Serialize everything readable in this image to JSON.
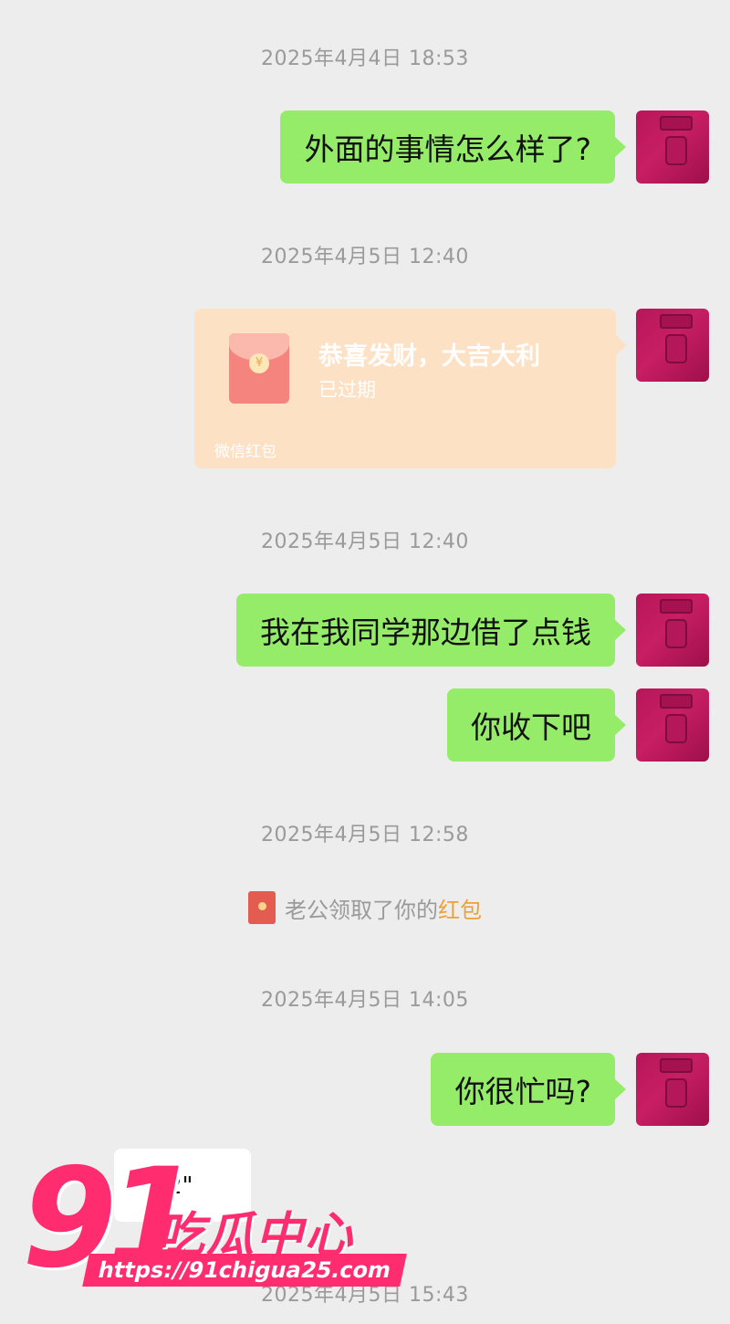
{
  "messages": [
    {
      "timestamp": "2025年4月4日 18:53",
      "text": "外面的事情怎么样了?"
    },
    {
      "timestamp": "2025年4月5日 12:40"
    },
    {
      "timestamp": "2025年4月5日 12:40",
      "text": "我在我同学那边借了点钱"
    },
    {
      "text": "你收下吧"
    },
    {
      "timestamp": "2025年4月5日 12:58"
    },
    {
      "timestamp": "2025年4月5日 14:05",
      "text": "你很忙吗?"
    },
    {
      "timestamp": "2025年4月5日 15:43"
    }
  ],
  "red_packet": {
    "title": "恭喜发财，大吉大利",
    "status": "已过期",
    "footer": "微信红包",
    "coin_symbol": "¥"
  },
  "system_message": {
    "prefix": "老公领取了你的",
    "link": "红包"
  },
  "voice_message": {
    "duration": "2\""
  },
  "watermark": {
    "number": "91",
    "brand": "吃瓜中心",
    "url": "https://91chigua25.com"
  },
  "colors": {
    "background": "#ededed",
    "sent_bubble": "#95ec69",
    "red_packet_expired": "#fde1c4",
    "link_orange": "#e9a23b",
    "watermark_pink": "#ff2d6f"
  }
}
